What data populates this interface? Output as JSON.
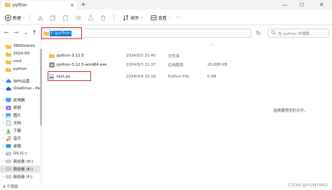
{
  "window": {
    "tab_title": "python",
    "min_symbol": "—",
    "max_symbol": "☐",
    "close_symbol": "✕",
    "newtab_symbol": "+"
  },
  "toolbar": {
    "new_label": "新建",
    "sort_label": "排序",
    "view_label": "查看",
    "more_label": "···"
  },
  "address": {
    "path": "E:\\python",
    "search_placeholder": "在 python 中搜索"
  },
  "sidebar": {
    "items": [
      {
        "label": "360Downlo",
        "icon": "folder-icon",
        "chevron": ""
      },
      {
        "label": "2024-09",
        "icon": "folder-icon",
        "chevron": ""
      },
      {
        "label": "conf",
        "icon": "folder-icon",
        "chevron": ""
      },
      {
        "label": "python",
        "icon": "folder-icon",
        "chevron": ""
      },
      {
        "label": "WPS云盘",
        "icon": "cloud-icon",
        "chevron": "›"
      },
      {
        "label": "OneDrive - Pe",
        "icon": "onedrive-icon",
        "chevron": "›"
      },
      {
        "label": "此电脑",
        "icon": "computer-icon",
        "chevron": "⌄"
      },
      {
        "label": "视频",
        "icon": "video-icon",
        "chevron": "›"
      },
      {
        "label": "图片",
        "icon": "picture-icon",
        "chevron": "›"
      },
      {
        "label": "文档",
        "icon": "document-icon",
        "chevron": "›"
      },
      {
        "label": "下载",
        "icon": "download-icon",
        "chevron": "›"
      },
      {
        "label": "音乐",
        "icon": "music-icon",
        "chevron": "›"
      },
      {
        "label": "桌面",
        "icon": "desktop-icon",
        "chevron": "›"
      },
      {
        "label": "OS (C:)",
        "icon": "drive-icon",
        "chevron": "›"
      },
      {
        "label": "新加卷 (D:)",
        "icon": "drive-icon",
        "chevron": "›"
      },
      {
        "label": "新加卷 (E:)",
        "icon": "drive-icon",
        "chevron": "›"
      },
      {
        "label": "新加卷 (F:)",
        "icon": "drive-icon",
        "chevron": "›"
      }
    ]
  },
  "files": {
    "rows": [
      {
        "name": "python-3.12.5",
        "date": "2024/9/3 21:45",
        "type": "文件夹",
        "size": "",
        "icon": "folder-icon"
      },
      {
        "name": "python-3.12.5-amd64.exe",
        "date": "2024/9/3 21:37",
        "type": "应用程序",
        "size": "25,888 KB",
        "icon": "exe-icon"
      },
      {
        "name": "text.py",
        "date": "2024/9/4 10:18",
        "type": "Python File",
        "size": "0 KB",
        "icon": "python-file-icon"
      }
    ]
  },
  "preview": {
    "message": "选择要预览的文件。"
  },
  "status": {
    "item_count": "3 个项目"
  },
  "watermark": "CSDN @YUNYIMO"
}
